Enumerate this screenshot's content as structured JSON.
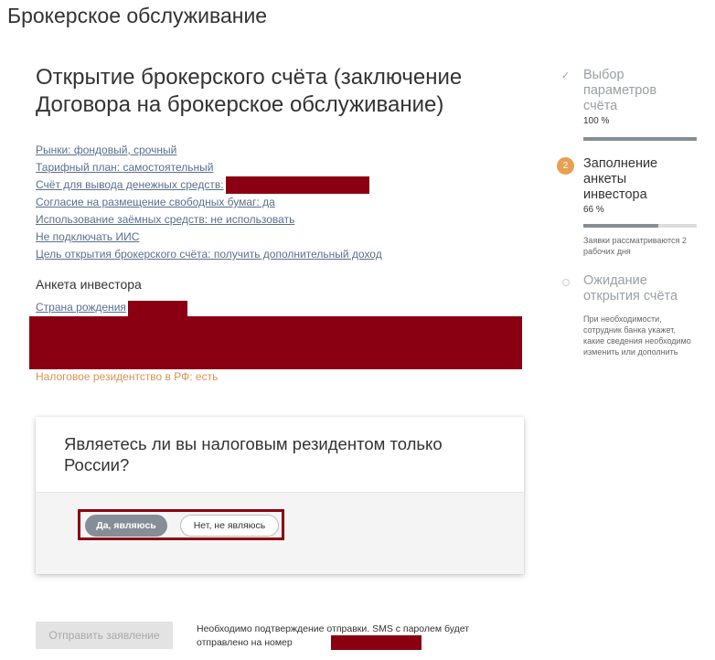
{
  "page": {
    "header": "Брокерское обслуживание",
    "title": "Открытие брокерского счёта (заключение Договора на брокерское обслуживание)"
  },
  "params": [
    "Рынки: фондовый, срочный",
    "Тарифный план: самостоятельный",
    "Счёт для вывода денежных средств:",
    "Согласие на размещение свободных бумаг: да",
    "Использование заёмных средств: не использовать",
    "Не подключать ИИС",
    "Цель открытия брокерского счёта: получить дополнительный доход"
  ],
  "investor": {
    "section_title": "Анкета инвестора",
    "country_label": "Страна рождения",
    "tax_residency": "Налоговое резидентство в РФ: есть"
  },
  "question_card": {
    "question": "Являетесь ли вы налоговым резидентом только России?",
    "yes_label": "Да, являюсь",
    "no_label": "Нет, не являюсь"
  },
  "footer": {
    "submit_label": "Отправить заявление",
    "confirm_text": "Необходимо подтверждение отправки. SMS с паролем будет отправлено на номер"
  },
  "steps": [
    {
      "mark": "✓",
      "title": "Выбор параметров счёта",
      "progress_text": "100 %",
      "progress": 1.0
    },
    {
      "number": "2",
      "title": "Заполнение анкеты инвестора",
      "progress_text": "66 %",
      "progress": 0.66,
      "note": "Заявки рассматриваются 2 рабочих дня"
    },
    {
      "title": "Ожидание открытия счёта",
      "note": "При необходимости, сотрудник банка укажет, какие сведения необходимо изменить или дополнить"
    }
  ],
  "colors": {
    "redaction": "#8a0012",
    "link": "#5a6f8c",
    "tax_text": "#d89152",
    "step_badge": "#e8a052",
    "button_selected": "#858d96"
  }
}
